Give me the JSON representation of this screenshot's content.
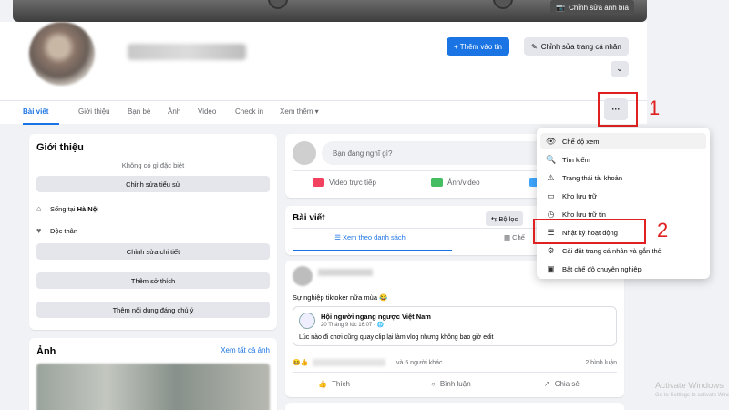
{
  "cover": {
    "edit_label": "Chỉnh sửa ảnh bìa",
    "edit_icon": "camera-icon"
  },
  "header": {
    "add_story": "+ Thêm vào tin",
    "edit_profile": "Chỉnh sửa trang cá nhân",
    "chevron": "⌄",
    "more": "···"
  },
  "tabs": [
    "Bài viết",
    "Giới thiệu",
    "Bạn bè",
    "Ảnh",
    "Video",
    "Check in",
    "Xem thêm ▾"
  ],
  "annotations": [
    "1",
    "2"
  ],
  "intro": {
    "title": "Giới thiệu",
    "bio": "Không có gì đặc biệt",
    "edit_bio": "Chỉnh sửa tiểu sử",
    "lives_prefix": "Sống tại ",
    "lives_city": "Hà Nội",
    "relationship": "Độc thân",
    "edit_details": "Chỉnh sửa chi tiết",
    "add_hobbies": "Thêm sở thích",
    "add_featured": "Thêm nội dung đáng chú ý"
  },
  "photos": {
    "title": "Ảnh",
    "see_all": "Xem tất cả ảnh"
  },
  "composer": {
    "placeholder": "Bạn đang nghĩ gì?",
    "live_video": "Video trực tiếp",
    "photo_video": "Ảnh/video"
  },
  "posts": {
    "title": "Bài viết",
    "filter": "⇆ Bộ lọc",
    "list_view": "☰ Xem theo danh sách",
    "grid_view": "▦ Chế",
    "caption": "Sự nghiệp tiktoker nữa mùa 😂",
    "shared_page": "Hội người ngang ngược Việt Nam",
    "shared_date": "20 Tháng 9 lúc 16:07 · 🌐",
    "shared_body": "Lúc nào đi chơi cũng quay clip lại làm vlog nhưng không bao giờ edit",
    "reactors": "và 5 người khác",
    "comments": "2 bình luận",
    "like": "Thích",
    "comment": "Bình luận",
    "share": "Chia sẻ"
  },
  "menu": [
    {
      "icon": "👁",
      "icon_name": "eye-icon",
      "label": "Chế độ xem"
    },
    {
      "icon": "🔍",
      "icon_name": "search-icon",
      "label": "Tìm kiếm"
    },
    {
      "icon": "⚠",
      "icon_name": "warning-icon",
      "label": "Trạng thái tài khoản"
    },
    {
      "icon": "▭",
      "icon_name": "archive-icon",
      "label": "Kho lưu trữ"
    },
    {
      "icon": "◷",
      "icon_name": "story-archive-icon",
      "label": "Kho lưu trữ tin"
    },
    {
      "icon": "☰",
      "icon_name": "activity-log-icon",
      "label": "Nhật ký hoạt động"
    },
    {
      "icon": "⚙",
      "icon_name": "settings-icon",
      "label": "Cài đặt trang cá nhân và gắn thẻ"
    },
    {
      "icon": "▣",
      "icon_name": "professional-icon",
      "label": "Bật chế độ chuyên nghiệp"
    }
  ],
  "watermark": {
    "line1": "Activate Windows",
    "line2": "Go to Settings to activate Windows."
  },
  "colors": {
    "accent": "#1b74e4",
    "annotation": "#e02020"
  }
}
